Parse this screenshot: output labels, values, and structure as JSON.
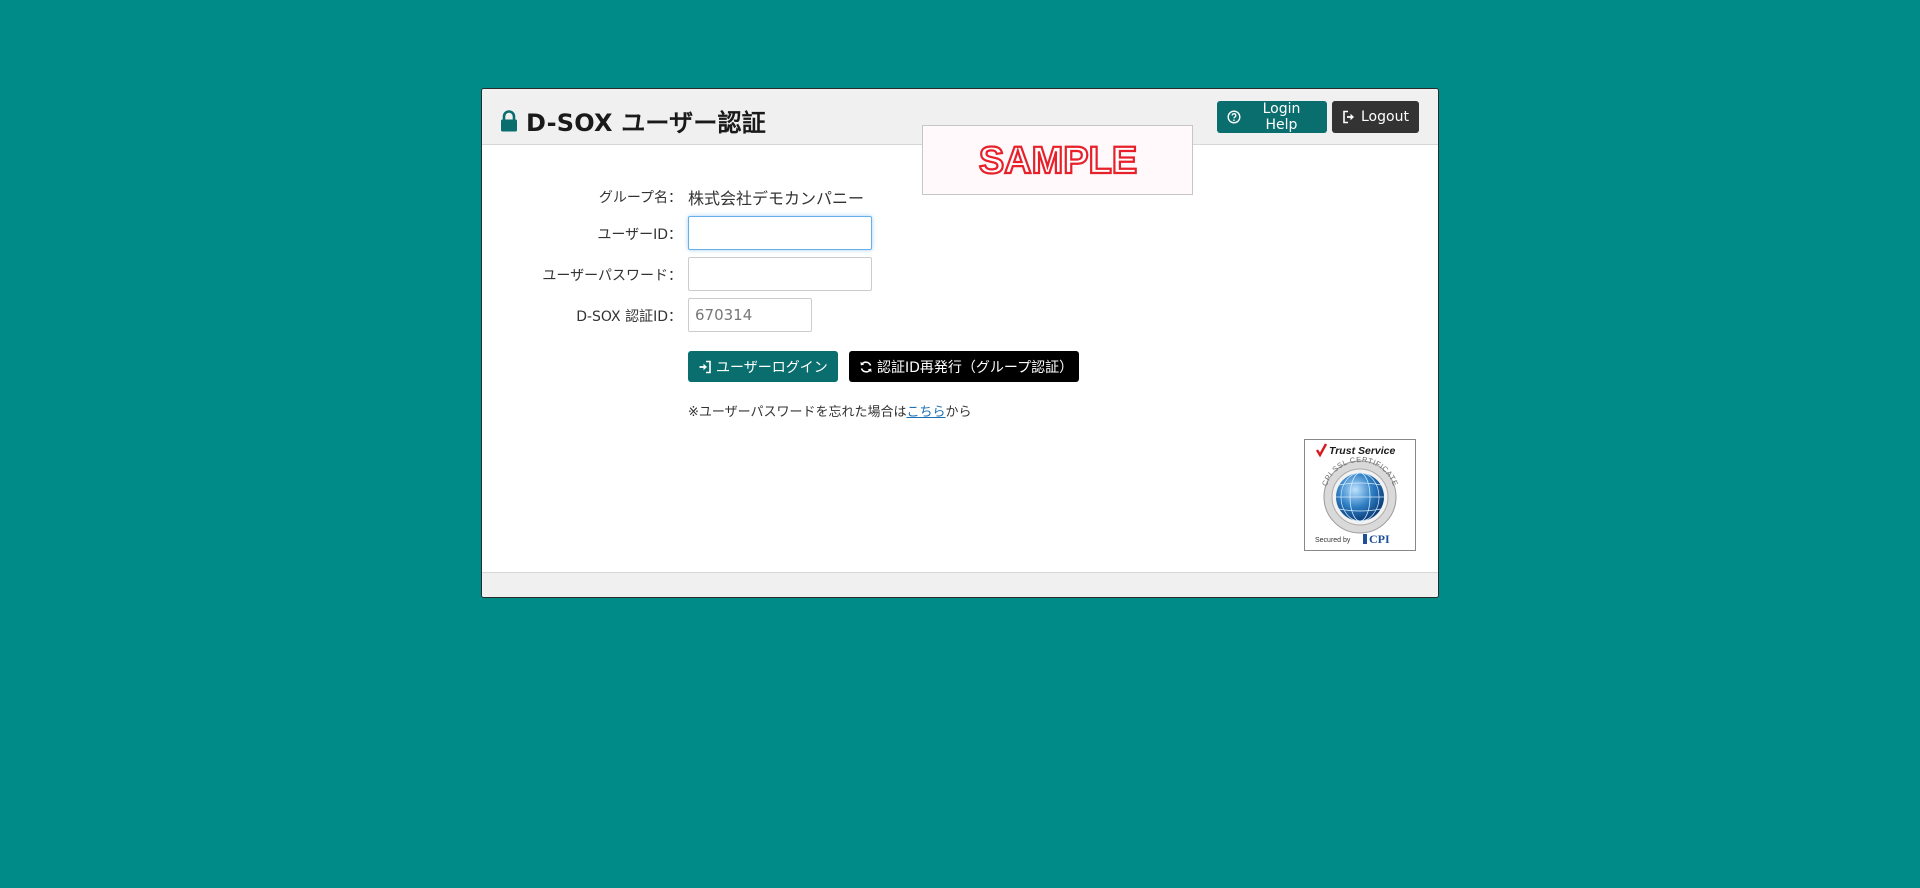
{
  "header": {
    "title": "D-SOX ユーザー認証",
    "login_help_label": "Login Help",
    "logout_label": "Logout"
  },
  "watermark": {
    "text": "SAMPLE",
    "color": "#e8202a"
  },
  "form": {
    "group_label": "グループ名：",
    "group_value": "株式会社デモカンパニー",
    "user_id_label": "ユーザーID：",
    "user_id_value": "",
    "password_label": "ユーザーパスワード：",
    "password_value": "",
    "auth_id_label": "D-SOX 認証ID：",
    "auth_id_value": "670314"
  },
  "actions": {
    "login_label": "ユーザーログイン",
    "reissue_label": "認証ID再発行（グループ認証）"
  },
  "note": {
    "prefix": "※ユーザーパスワードを忘れた場合は",
    "link": "こちら",
    "suffix": "から"
  },
  "seal": {
    "title": "Trust Service",
    "ring_text": "CPI SSL CERTIFICATE",
    "secured_by": "Secured by",
    "brand": "CPI"
  },
  "colors": {
    "background": "#008a88",
    "accent": "#0b6e6e",
    "logout": "#333333"
  },
  "icons": {
    "title": "lock-icon",
    "help": "question-circle-icon",
    "logout": "logout-icon",
    "login": "login-icon",
    "reissue": "refresh-icon"
  }
}
